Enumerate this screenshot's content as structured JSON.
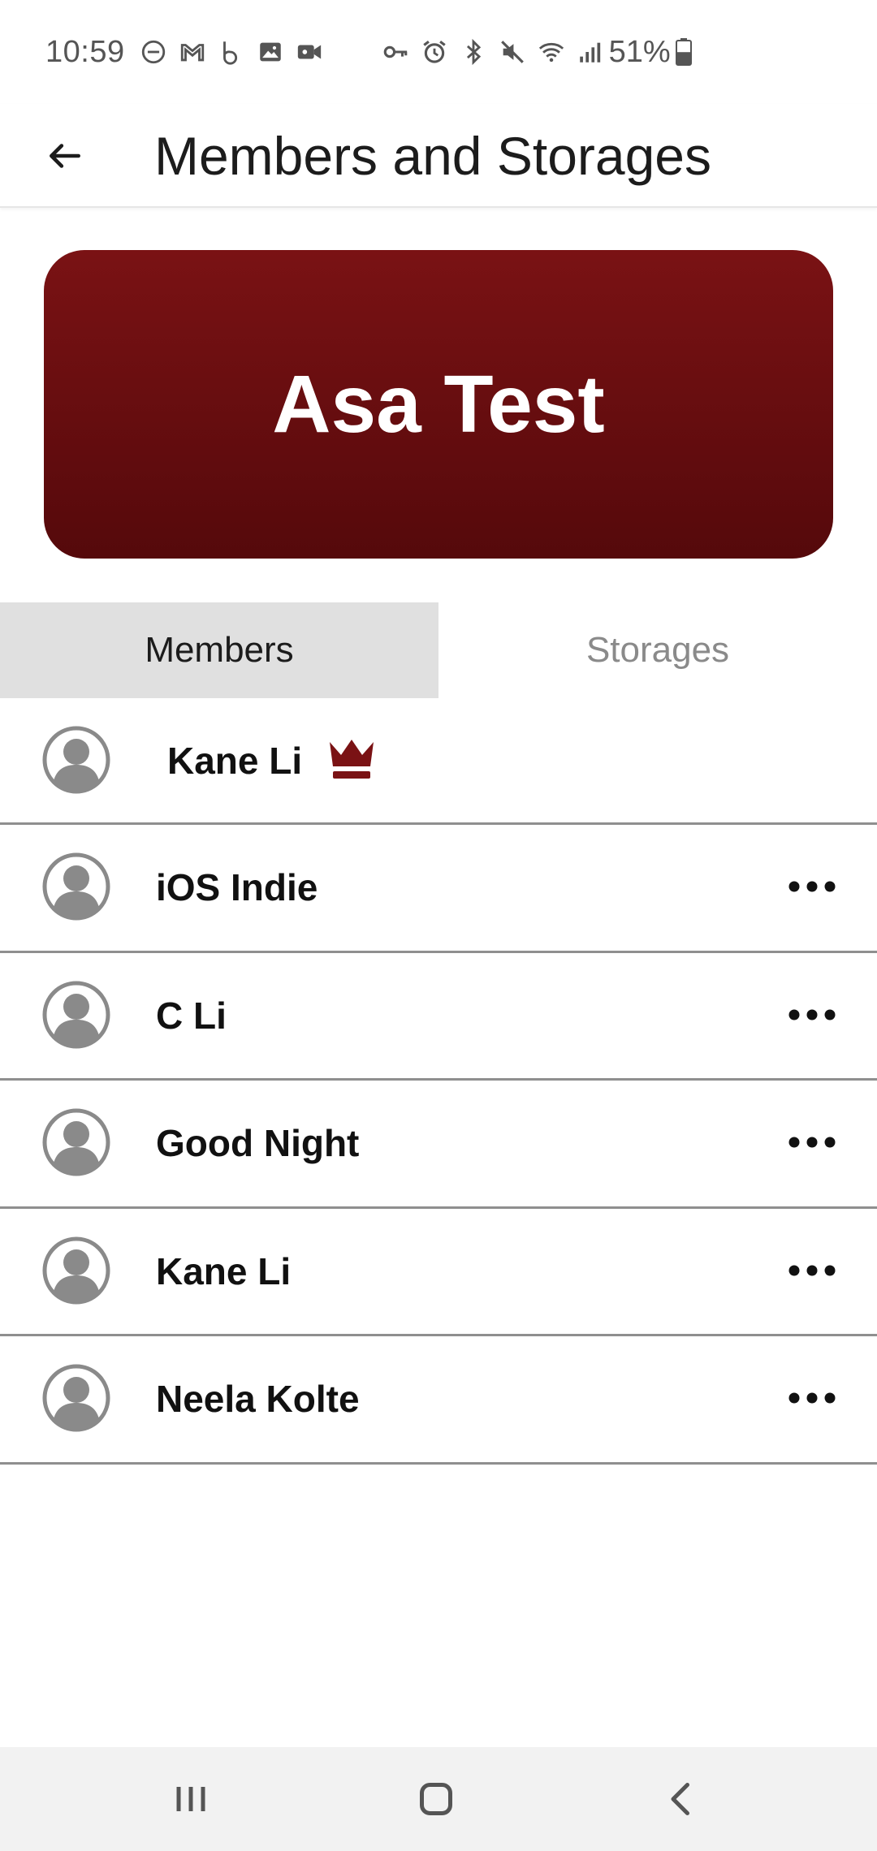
{
  "status_bar": {
    "time": "10:59",
    "battery_percent": "51%",
    "battery_level": 0.51,
    "left_icons": [
      "dnd-icon",
      "gmail-icon",
      "b-app-icon",
      "gallery-icon",
      "video-icon"
    ],
    "right_icons": [
      "vpn-key-icon",
      "alarm-icon",
      "bluetooth-icon",
      "mute-icon",
      "wifi-icon",
      "signal-icon"
    ]
  },
  "header": {
    "title": "Members and Storages",
    "back_icon": "arrow-left-icon"
  },
  "group": {
    "name": "Asa Test",
    "banner_color_top": "#7a1214",
    "banner_color_bottom": "#55090b"
  },
  "tabs": [
    {
      "label": "Members",
      "active": true
    },
    {
      "label": "Storages",
      "active": false
    }
  ],
  "members": [
    {
      "name": "Kane Li",
      "is_owner": true,
      "badge_icon": "crown-icon"
    },
    {
      "name": "iOS Indie",
      "is_owner": false,
      "action_icon": "more-horizontal-icon"
    },
    {
      "name": "C Li",
      "is_owner": false,
      "action_icon": "more-horizontal-icon"
    },
    {
      "name": "Good Night",
      "is_owner": false,
      "action_icon": "more-horizontal-icon"
    },
    {
      "name": "Kane Li",
      "is_owner": false,
      "action_icon": "more-horizontal-icon"
    },
    {
      "name": "Neela Kolte",
      "is_owner": false,
      "action_icon": "more-horizontal-icon"
    }
  ],
  "nav_bar": {
    "icons": [
      "recents-icon",
      "home-icon",
      "back-icon"
    ]
  },
  "colors": {
    "accent": "#7a1214",
    "tab_active_bg": "#e0e0e0",
    "tab_inactive_text": "#8a8a8a",
    "divider": "#8f8f8f",
    "avatar_grey": "#8a8a8a"
  }
}
